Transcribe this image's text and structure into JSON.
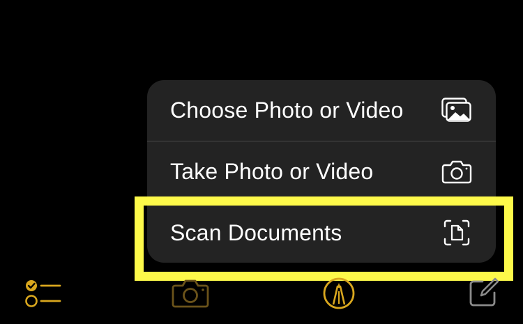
{
  "menu": {
    "items": [
      {
        "label": "Choose Photo or Video",
        "icon": "photo-library-icon"
      },
      {
        "label": "Take Photo or Video",
        "icon": "camera-icon"
      },
      {
        "label": "Scan Documents",
        "icon": "document-scanner-icon"
      }
    ],
    "highlighted_item": "Scan Documents"
  },
  "toolbar": {
    "buttons": [
      {
        "icon": "checklist-icon",
        "enabled": true
      },
      {
        "icon": "camera-icon",
        "enabled": false
      },
      {
        "icon": "markup-pen-icon",
        "enabled": true
      },
      {
        "icon": "compose-icon",
        "enabled": true
      }
    ]
  },
  "colors": {
    "background": "#000000",
    "menu_background": "#232323",
    "menu_text": "#ffffff",
    "accent": "#d9a71e",
    "accent_dim": "#6b531a",
    "highlight_border": "#fdf94a",
    "compose_icon": "#8a8a8a"
  }
}
